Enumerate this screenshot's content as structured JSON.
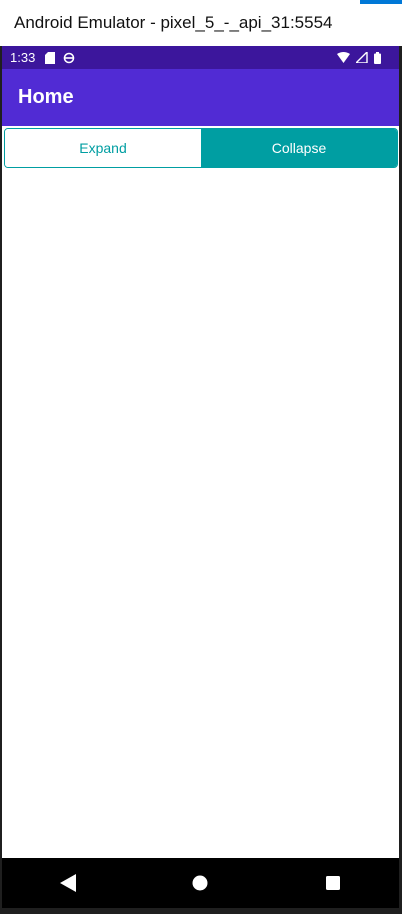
{
  "window": {
    "title": "Android Emulator - pixel_5_-_api_31:5554"
  },
  "colors": {
    "status_bar": "#3c169c",
    "app_bar": "#512bd4",
    "accent": "#009ea2",
    "nav_bar": "#000000"
  },
  "status_bar": {
    "time": "1:33",
    "left_icons": [
      "sd-card-icon",
      "sync-icon"
    ],
    "right_icons": [
      "wifi-icon",
      "signal-icon",
      "battery-icon"
    ]
  },
  "app_bar": {
    "title": "Home"
  },
  "segmented_control": {
    "selected": "Collapse",
    "options": [
      {
        "label": "Expand"
      },
      {
        "label": "Collapse"
      }
    ]
  },
  "nav_bar": {
    "buttons": [
      "back-icon",
      "home-icon",
      "recents-icon"
    ]
  }
}
